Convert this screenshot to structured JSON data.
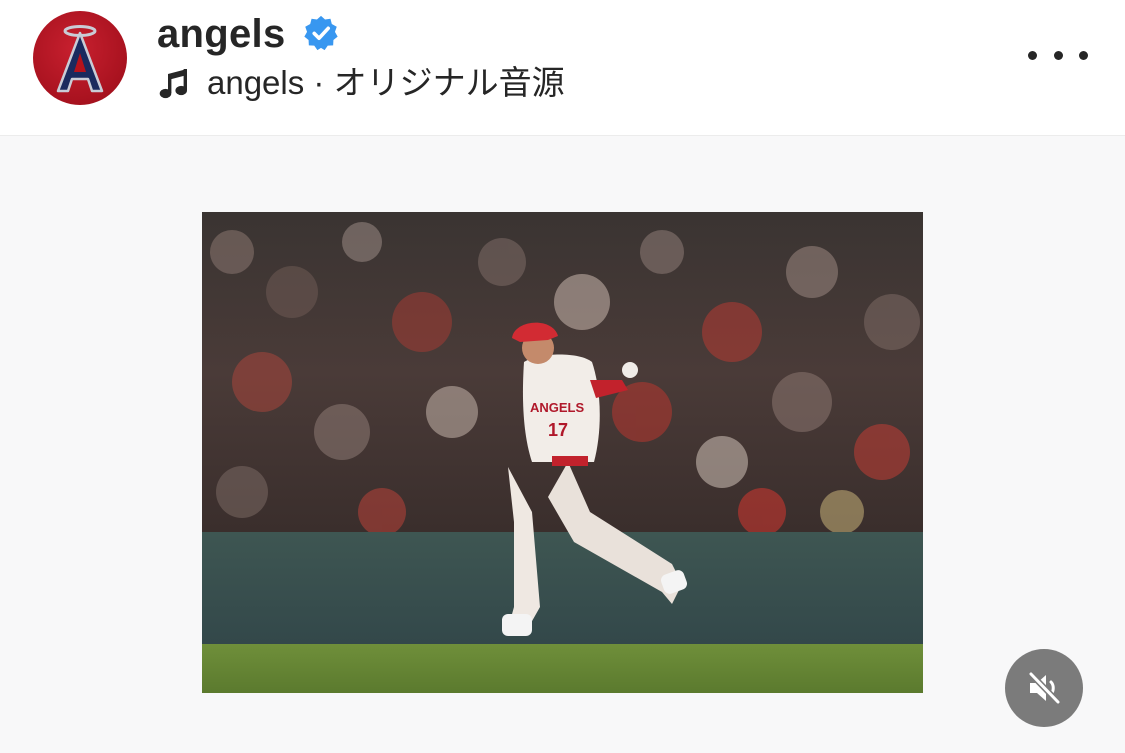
{
  "post_header": {
    "username": "angels",
    "verified": true,
    "audio": {
      "artist": "angels",
      "separator": " · ",
      "title": "オリジナル音源"
    },
    "more_icon": "more-horizontal-icon"
  },
  "media": {
    "jersey_text": "ANGELS",
    "jersey_number": "17",
    "mute_icon": "muted-speaker-icon"
  },
  "colors": {
    "brand_red": "#ba0021",
    "verified_blue": "#3897f0"
  }
}
